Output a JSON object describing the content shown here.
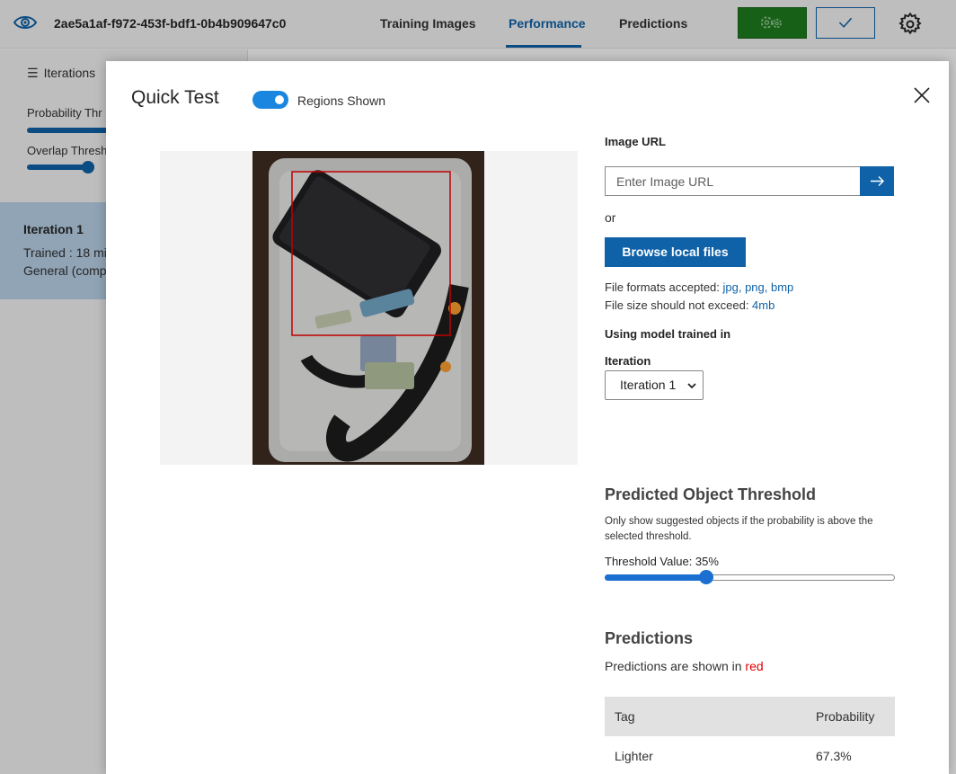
{
  "header": {
    "project_id": "2ae5a1af-f972-453f-bdf1-0b4b909647c0",
    "tabs": [
      {
        "label": "Training Images"
      },
      {
        "label": "Performance"
      },
      {
        "label": "Predictions"
      }
    ],
    "active_tab": "Performance",
    "icons": [
      "eye-icon",
      "gears-icon",
      "checkmark-icon",
      "gear-icon"
    ]
  },
  "sidebar": {
    "iterations_label": "Iterations",
    "probability_label": "Probability Thr",
    "overlap_label": "Overlap Thresh",
    "iteration": {
      "name": "Iteration 1",
      "trained": "Trained : 18 mi",
      "domain": "General (compa"
    }
  },
  "modal": {
    "title": "Quick Test",
    "toggle_label": "Regions Shown",
    "toggle_on": true,
    "image_url_label": "Image URL",
    "image_url_placeholder": "Enter Image URL",
    "or_text": "or",
    "browse_label": "Browse local files",
    "formats_prefix": "File formats accepted: ",
    "formats": "jpg, png, bmp",
    "size_prefix": "File size should not exceed: ",
    "size": "4mb",
    "model_label": "Using model trained in",
    "iteration_label": "Iteration",
    "iteration_value": "Iteration 1",
    "threshold_title": "Predicted Object Threshold",
    "threshold_desc": "Only show suggested objects if the probability is above the selected threshold.",
    "threshold_label": "Threshold Value: 35%",
    "threshold_value": 0.35,
    "predictions_title": "Predictions",
    "predictions_note_prefix": "Predictions are shown in ",
    "predictions_note_color": "red",
    "table": {
      "headers": [
        "Tag",
        "Probability"
      ],
      "rows": [
        {
          "tag": "Lighter",
          "probability": "67.3%"
        }
      ]
    }
  },
  "colors": {
    "accent": "#0f62a8",
    "train_button": "#1e7b1e",
    "toggle": "#1a86e0",
    "region": "#e00000"
  }
}
